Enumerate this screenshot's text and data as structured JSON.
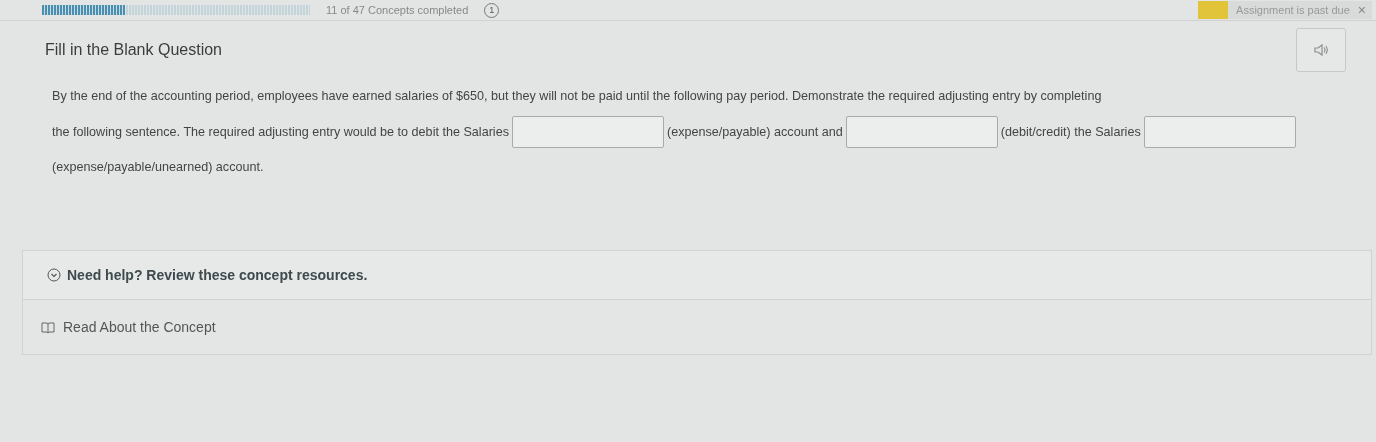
{
  "top_bar": {
    "progress": {
      "level": 0.31
    },
    "progress_text": "11 of 47 Concepts completed",
    "info_badge": "1",
    "alert": {
      "text": "Assignment is past due",
      "close": "×"
    }
  },
  "question": {
    "title": "Fill in the Blank Question",
    "parts": [
      {
        "kind": "text",
        "text": "By the end of the accounting period, employees have earned salaries of $650, but they will not be paid until the following pay period. Demonstrate the required adjusting entry by completing"
      },
      {
        "kind": "text",
        "text": "the following sentence. The required adjusting entry would be to debit the Salaries"
      },
      {
        "kind": "blank"
      },
      {
        "kind": "text",
        "text": "(expense/payable) account and"
      },
      {
        "kind": "blank"
      },
      {
        "kind": "text",
        "text": "(debit/credit) the Salaries"
      },
      {
        "kind": "blank"
      },
      {
        "kind": "text",
        "text": "(expense/payable/unearned) account."
      }
    ]
  },
  "help": {
    "title": "Need help? Review these concept resources.",
    "expanded": true,
    "resources": [
      {
        "label": "Read About the Concept"
      }
    ]
  }
}
